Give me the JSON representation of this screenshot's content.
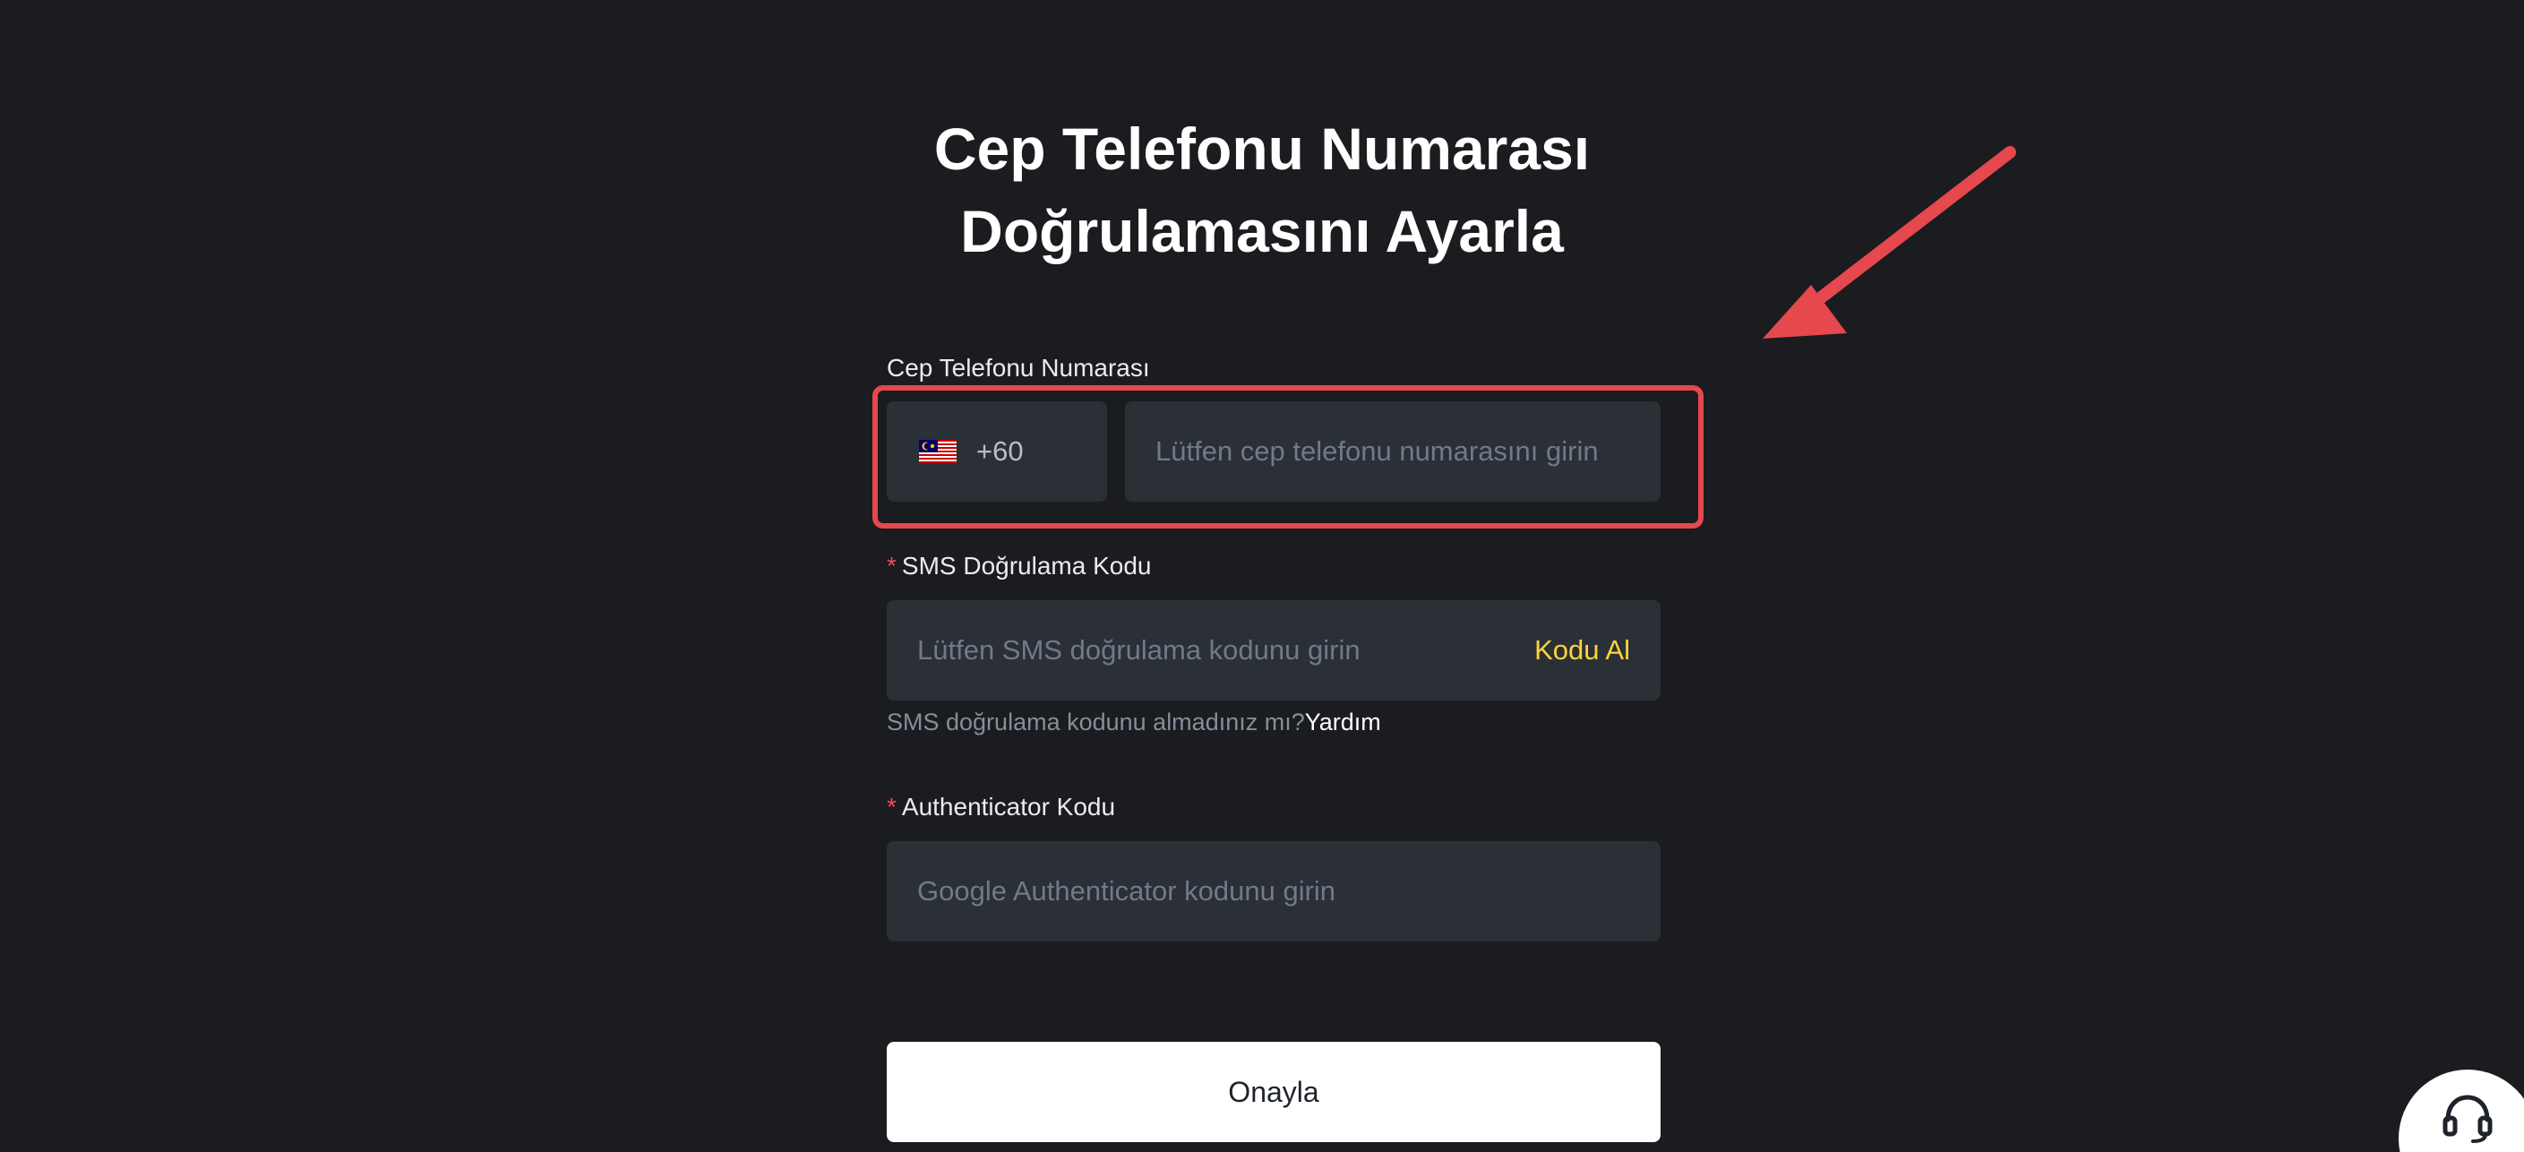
{
  "title": {
    "line1": "Cep Telefonu Numarası",
    "line2": "Doğrulamasını Ayarla"
  },
  "phone": {
    "label": "Cep Telefonu Numarası",
    "country_code": "+60",
    "country_flag": "malaysia-flag-icon",
    "placeholder": "Lütfen cep telefonu numarasını girin"
  },
  "sms": {
    "required_mark": "*",
    "label": "SMS Doğrulama Kodu",
    "placeholder": "Lütfen SMS doğrulama kodunu girin",
    "get_code_label": "Kodu Al",
    "help_text": "SMS doğrulama kodunu almadınız mı?",
    "help_link": "Yardım"
  },
  "authenticator": {
    "required_mark": "*",
    "label": "Authenticator Kodu",
    "placeholder": "Google Authenticator kodunu girin"
  },
  "confirm_button": "Onayla",
  "support_icon": "headset-icon",
  "annotation": {
    "arrow_icon": "red-arrow-icon",
    "highlight_color": "#e5484d"
  },
  "colors": {
    "background": "#1b1c1f",
    "input_background": "#2b2f36",
    "accent": "#fcd535",
    "required": "#f6465d"
  }
}
